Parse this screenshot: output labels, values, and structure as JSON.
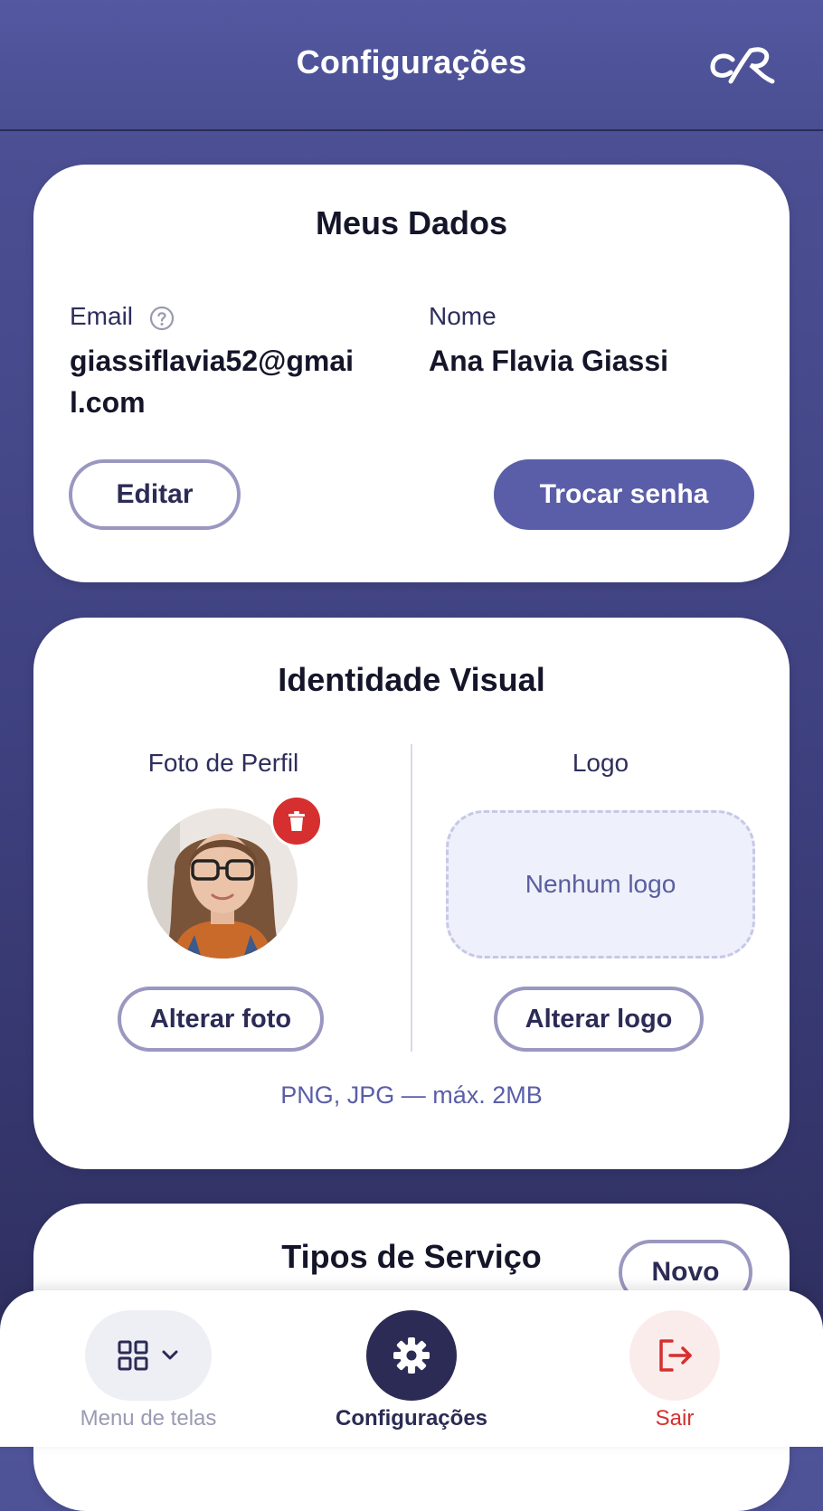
{
  "header": {
    "title": "Configurações",
    "logo_icon": "brand-monogram-icon"
  },
  "meus_dados": {
    "title": "Meus Dados",
    "email_label": "Email",
    "email_value_line1": "giassiflavia52@gmai",
    "email_value_line2": "l.com",
    "nome_label": "Nome",
    "nome_value": "Ana Flavia Giassi",
    "edit_button": "Editar",
    "change_password_button": "Trocar senha"
  },
  "identidade": {
    "title": "Identidade Visual",
    "foto_label": "Foto de Perfil",
    "logo_label": "Logo",
    "logo_placeholder": "Nenhum logo",
    "change_photo_button": "Alterar foto",
    "change_logo_button": "Alterar logo",
    "hint": "PNG, JPG — máx. 2MB"
  },
  "tipos": {
    "title": "Tipos de Serviço",
    "new_button": "Novo"
  },
  "bottom_nav": {
    "menu_label": "Menu de telas",
    "settings_label": "Configurações",
    "logout_label": "Sair"
  },
  "colors": {
    "accent": "#5a5ea8",
    "danger": "#d62f2f",
    "active_nav": "#2b2b55"
  }
}
